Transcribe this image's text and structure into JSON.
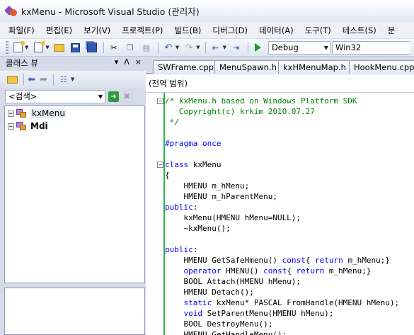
{
  "window": {
    "title": "kxMenu - Microsoft Visual Studio (관리자)"
  },
  "menubar": {
    "items": [
      "파일(F)",
      "편집(E)",
      "보기(V)",
      "프로젝트(P)",
      "빌드(B)",
      "디버그(D)",
      "데이터(A)",
      "도구(T)",
      "테스트(S)",
      "분"
    ]
  },
  "toolbar": {
    "config_value": "Debug",
    "platform_value": "Win32"
  },
  "class_view": {
    "title": "클래스 뷰",
    "head_buttons": [
      "▾",
      "ᐱ",
      "×"
    ],
    "search_value": "<검색>",
    "tree": [
      {
        "label": "kxMenu",
        "bold": false,
        "selected": true
      },
      {
        "label": "Mdi",
        "bold": true,
        "selected": false
      }
    ]
  },
  "editor": {
    "tabs": [
      "SWFrame.cpp",
      "MenuSpawn.h",
      "kxHMenuMap.h",
      "HookMenu.cpp"
    ],
    "scope_combo": "(전역 범위)",
    "code_lines": [
      [
        {
          "t": "/* kxMenu.h based on Windows Platform SDK",
          "c": "cm"
        }
      ],
      [
        {
          "t": "   Copyright(c) krkim 2010.07.27",
          "c": "cm"
        }
      ],
      [
        {
          "t": " */",
          "c": "cm"
        }
      ],
      [],
      [
        {
          "t": "#pragma once",
          "c": "pp"
        }
      ],
      [],
      [
        {
          "t": "class",
          "c": "kw"
        },
        {
          "t": " kxMenu",
          "c": ""
        }
      ],
      [
        {
          "t": "{",
          "c": ""
        }
      ],
      [
        {
          "t": "    HMENU m_hMenu;",
          "c": ""
        }
      ],
      [
        {
          "t": "    HMENU m_hParentMenu;",
          "c": ""
        }
      ],
      [
        {
          "t": "public",
          "c": "kw"
        },
        {
          "t": ":",
          "c": ""
        }
      ],
      [
        {
          "t": "    kxMenu(HMENU hMenu=NULL);",
          "c": ""
        }
      ],
      [
        {
          "t": "    ~kxMenu();",
          "c": ""
        }
      ],
      [],
      [
        {
          "t": "public",
          "c": "kw"
        },
        {
          "t": ":",
          "c": ""
        }
      ],
      [
        {
          "t": "    HMENU GetSafeHmenu() ",
          "c": ""
        },
        {
          "t": "const",
          "c": "kw"
        },
        {
          "t": "{ ",
          "c": ""
        },
        {
          "t": "return",
          "c": "kw"
        },
        {
          "t": " m_hMenu;}",
          "c": ""
        }
      ],
      [
        {
          "t": "    ",
          "c": ""
        },
        {
          "t": "operator",
          "c": "kw"
        },
        {
          "t": " HMENU() ",
          "c": ""
        },
        {
          "t": "const",
          "c": "kw"
        },
        {
          "t": "{ ",
          "c": ""
        },
        {
          "t": "return",
          "c": "kw"
        },
        {
          "t": " m_hMenu;}",
          "c": ""
        }
      ],
      [
        {
          "t": "    BOOL Attach(HMENU hMenu);",
          "c": ""
        }
      ],
      [
        {
          "t": "    HMENU Detach();",
          "c": ""
        }
      ],
      [
        {
          "t": "    ",
          "c": ""
        },
        {
          "t": "static",
          "c": "kw"
        },
        {
          "t": " kxMenu* PASCAL FromHandle(HMENU hMenu);",
          "c": ""
        }
      ],
      [
        {
          "t": "    ",
          "c": ""
        },
        {
          "t": "void",
          "c": "kw"
        },
        {
          "t": " SetParentMenu(HMENU hMenu);",
          "c": ""
        }
      ],
      [
        {
          "t": "    BOOL DestroyMenu();",
          "c": ""
        }
      ],
      [
        {
          "t": "    HMENU GetHandleMenu();",
          "c": ""
        }
      ]
    ]
  }
}
